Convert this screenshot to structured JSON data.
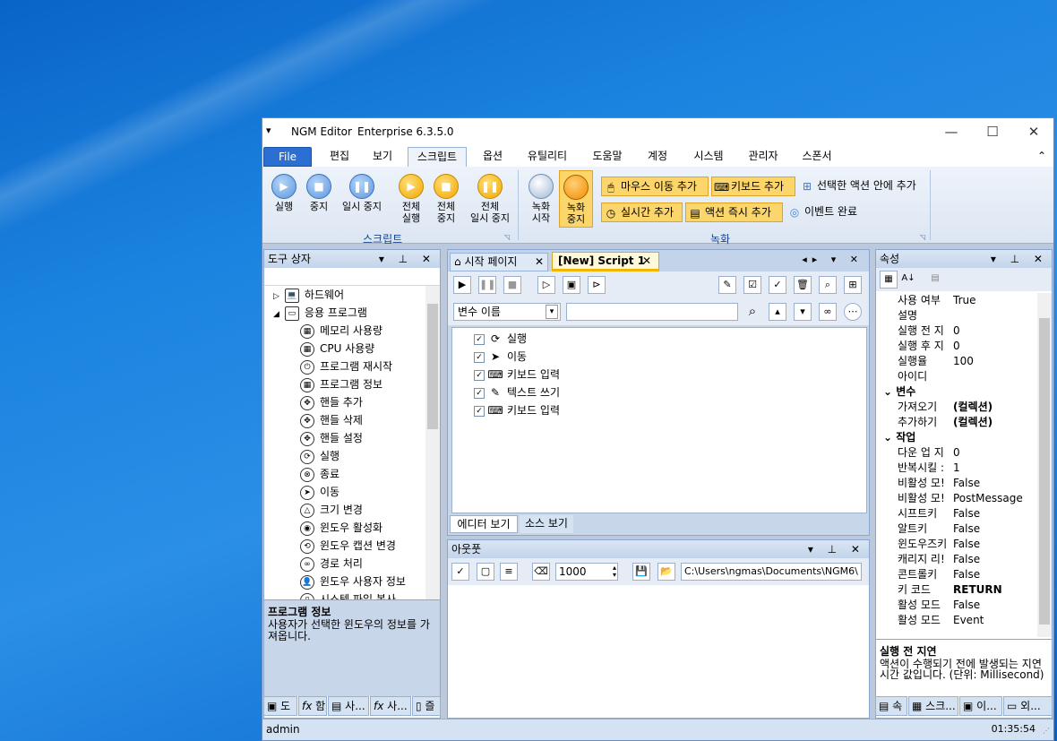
{
  "title": {
    "app": "NGM Editor",
    "edition": "Enterprise 6.3.5.0",
    "sysmenu": "▾",
    "min": "—",
    "max": "☐",
    "close": "✕"
  },
  "menu": {
    "file": "File",
    "tabs": [
      "편집",
      "보기",
      "스크립트",
      "옵션",
      "유틸리티",
      "도움말",
      "계정",
      "시스템",
      "관리자",
      "스폰서"
    ],
    "collapse": "⌃"
  },
  "ribbon": {
    "script": {
      "run": "실행",
      "stop": "중지",
      "pause": "일시 중지",
      "all_run_1": "전체",
      "all_run_2": "실행",
      "all_stop_1": "전체",
      "all_stop_2": "중지",
      "all_pause_1": "전체",
      "all_pause_2": "일시 중지",
      "group": "스크립트"
    },
    "record": {
      "start_1": "녹화",
      "start_2": "시작",
      "stop_1": "녹화",
      "stop_2": "중지",
      "mouse": "마우스 이동 추가",
      "keyboard": "키보드 추가",
      "selected": "선택한 액션 안에 추가",
      "realtime": "실시간 추가",
      "instant": "액션 즉시 추가",
      "event": "이벤트 완료",
      "group": "녹화"
    }
  },
  "toolbox": {
    "title": "도구 상자",
    "tree": [
      {
        "label": "하드웨어",
        "indent": 0,
        "expand": "▷"
      },
      {
        "label": "응용 프로그램",
        "indent": 0,
        "expand": "◢"
      },
      {
        "label": "메모리 사용량",
        "indent": 1
      },
      {
        "label": "CPU 사용량",
        "indent": 1
      },
      {
        "label": "프로그램 재시작",
        "indent": 1
      },
      {
        "label": "프로그램 정보",
        "indent": 1
      },
      {
        "label": "핸들 추가",
        "indent": 1
      },
      {
        "label": "핸들 삭제",
        "indent": 1
      },
      {
        "label": "핸들 설정",
        "indent": 1
      },
      {
        "label": "실행",
        "indent": 1
      },
      {
        "label": "종료",
        "indent": 1
      },
      {
        "label": "이동",
        "indent": 1
      },
      {
        "label": "크기 변경",
        "indent": 1
      },
      {
        "label": "윈도우 활성화",
        "indent": 1
      },
      {
        "label": "윈도우 캡션 변경",
        "indent": 1
      },
      {
        "label": "경로 처리",
        "indent": 1
      },
      {
        "label": "윈도우 사용자 정보",
        "indent": 1
      },
      {
        "label": "시스템 파일 복사",
        "indent": 1
      }
    ],
    "desc_title": "프로그램 정보",
    "desc_text": "사용자가 선택한 윈도우의 정보를 가져옵니다.",
    "tabs": [
      "도",
      "함",
      "사...",
      "사...",
      "즐"
    ]
  },
  "editor": {
    "tab_home": "시작 페이지",
    "tab_script": "[New] Script 1",
    "var_label": "변수 이름",
    "var_search_placeholder": "",
    "actions": [
      {
        "label": "실행",
        "icon": "⟳"
      },
      {
        "label": "이동",
        "icon": "➤"
      },
      {
        "label": "키보드 입력",
        "icon": "⌨"
      },
      {
        "label": "텍스트 쓰기",
        "icon": "✎"
      },
      {
        "label": "키보드 입력",
        "icon": "⌨"
      }
    ],
    "tab_editor": "에디터 보기",
    "tab_source": "소스 보기"
  },
  "output": {
    "title": "아웃풋",
    "count": "1000",
    "path": "C:\\Users\\ngmas\\Documents\\NGM6\\"
  },
  "props": {
    "title": "속성",
    "rows": [
      {
        "k": "사용 여부",
        "v": "True"
      },
      {
        "k": "설명",
        "v": ""
      },
      {
        "k": "실행 전 지",
        "v": "0"
      },
      {
        "k": "실행 후 지",
        "v": "0"
      },
      {
        "k": "실행율",
        "v": "100"
      },
      {
        "k": "아이디",
        "v": ""
      },
      {
        "cat": "변수"
      },
      {
        "k": "가져오기",
        "v": "(컬렉션)",
        "b": true
      },
      {
        "k": "추가하기",
        "v": "(컬렉션)",
        "b": true
      },
      {
        "cat": "작업"
      },
      {
        "k": "다운 업 지",
        "v": "0"
      },
      {
        "k": "반복시킬 :",
        "v": "1"
      },
      {
        "k": "비활성 모!",
        "v": "False"
      },
      {
        "k": "비활성 모!",
        "v": "PostMessage"
      },
      {
        "k": "시프트키",
        "v": "False"
      },
      {
        "k": "알트키",
        "v": "False"
      },
      {
        "k": "윈도우즈키",
        "v": "False"
      },
      {
        "k": "캐리지 리!",
        "v": "False"
      },
      {
        "k": "콘트롤키",
        "v": "False"
      },
      {
        "k": "키 코드",
        "v": "RETURN",
        "b": true
      },
      {
        "k": "활성 모드",
        "v": "False"
      },
      {
        "k": "활성 모드",
        "v": "Event"
      }
    ],
    "desc_title": "실행 전 지연",
    "desc_text": "액션이 수행되기 전에 발생되는 지연 시간 값입니다. (단위: Millisecond)",
    "tabs": [
      "속",
      "스크...",
      "이...",
      "외..."
    ]
  },
  "status": {
    "user": "admin",
    "time": "01:35:54"
  }
}
